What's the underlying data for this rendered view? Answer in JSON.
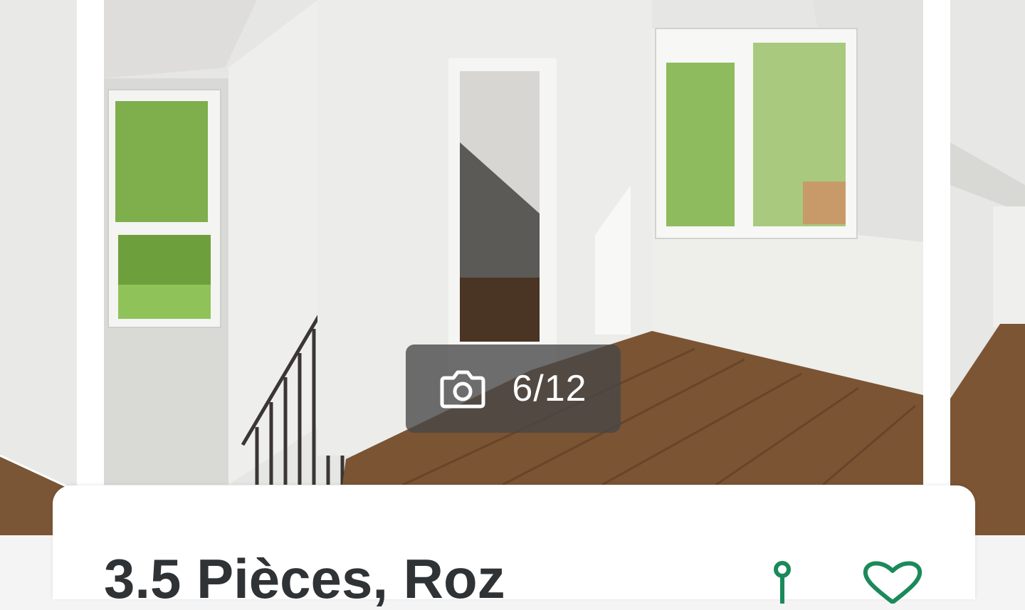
{
  "gallery": {
    "current": 6,
    "total": 12,
    "counter_text": "6/12",
    "camera_icon": "camera-icon"
  },
  "listing": {
    "title": "3.5 Pièces, Roz"
  },
  "actions": {
    "share_icon": "share-icon",
    "favorite_icon": "heart-icon",
    "accent_color": "#1b8a5a"
  }
}
